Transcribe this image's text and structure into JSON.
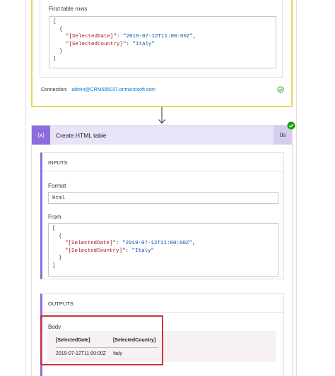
{
  "top_card": {
    "rows_label": "First table rows",
    "rows_code": [
      {
        "t": "p",
        "text": "["
      },
      {
        "t": "p",
        "text": "  {"
      },
      {
        "t": "kv",
        "key": "    \"[SelectedDate]\"",
        "sep": ": ",
        "val": "\"2019-07-12T11:00:00Z\"",
        "end": ","
      },
      {
        "t": "kv",
        "key": "    \"[SelectedCountry]\"",
        "sep": ": ",
        "val": "\"Italy\"",
        "end": ""
      },
      {
        "t": "p",
        "text": "  }"
      },
      {
        "t": "p",
        "text": "]"
      }
    ],
    "connection_label": "Connection:",
    "connection_value": "admin@CRM685037.onmicrosoft.com"
  },
  "action": {
    "icon": "{x}",
    "title": "Create HTML table",
    "duration": "0s",
    "status_color": "#13a10e",
    "inputs": {
      "title": "INPUTS",
      "format_label": "Format",
      "format_value": "Html",
      "from_label": "From",
      "from_code": [
        {
          "t": "p",
          "text": "["
        },
        {
          "t": "p",
          "text": "  {"
        },
        {
          "t": "kv",
          "key": "    \"[SelectedDate]\"",
          "sep": ": ",
          "val": "\"2019-07-12T11:00:00Z\"",
          "end": ","
        },
        {
          "t": "kv",
          "key": "    \"[SelectedCountry]\"",
          "sep": ": ",
          "val": "\"Italy\"",
          "end": ""
        },
        {
          "t": "p",
          "text": "  }"
        },
        {
          "t": "p",
          "text": "]"
        }
      ]
    },
    "outputs": {
      "title": "OUTPUTS",
      "body_label": "Body",
      "table": {
        "headers": [
          "[SelectedDate]",
          "[SelectedCountry]"
        ],
        "rows": [
          [
            "2019-07-12T11:00:00Z",
            "Italy"
          ]
        ]
      }
    }
  },
  "colors": {
    "top_card_border": "#e8d65a",
    "action_accent": "#8c6cde",
    "highlight": "#d13438"
  }
}
